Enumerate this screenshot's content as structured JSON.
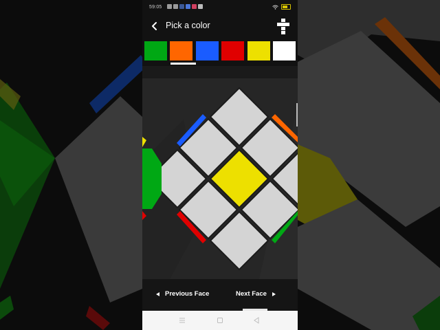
{
  "status_bar": {
    "time": "59:05"
  },
  "app_bar": {
    "title": "Pick a color",
    "back_icon": "back-arrow-icon",
    "cube_icon": "cube-net-icon"
  },
  "palette": {
    "colors": [
      {
        "name": "green",
        "hex": "#00a814"
      },
      {
        "name": "orange",
        "hex": "#ff6600"
      },
      {
        "name": "blue",
        "hex": "#1a5cff"
      },
      {
        "name": "red",
        "hex": "#e00000"
      },
      {
        "name": "yellow",
        "hex": "#ede000"
      },
      {
        "name": "white",
        "hex": "#ffffff"
      }
    ],
    "selected_index": 1
  },
  "cube_face": {
    "center_color": "#ede000",
    "sticker_color": "#d4d4d4",
    "edge_colors": {
      "top_left": "#1a5cff",
      "top_right": "#ff6600",
      "bottom_left": "#e00000",
      "bottom_right": "#00a814",
      "left_side": "#00a814"
    }
  },
  "navigation": {
    "previous_label": "Previous Face",
    "next_label": "Next Face"
  }
}
